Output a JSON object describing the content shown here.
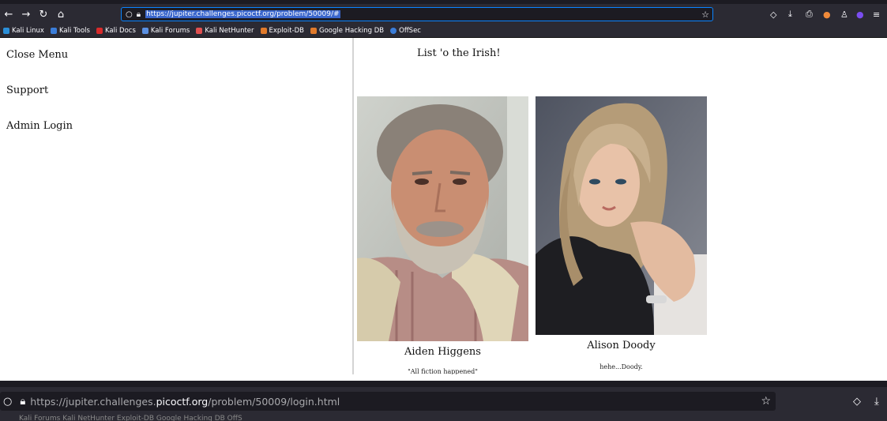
{
  "browser_top": {
    "url": "https://jupiter.challenges.picoctf.org/problem/50009/#",
    "bookmarks": [
      {
        "label": "Kali Linux",
        "color": "#2b8fd8"
      },
      {
        "label": "Kali Tools",
        "color": "#3b7dd8"
      },
      {
        "label": "Kali Docs",
        "color": "#d82b2b"
      },
      {
        "label": "Kali Forums",
        "color": "#5a8fe0"
      },
      {
        "label": "Kali NetHunter",
        "color": "#e05050"
      },
      {
        "label": "Exploit-DB",
        "color": "#e07a2b"
      },
      {
        "label": "Google Hacking DB",
        "color": "#e07a2b"
      },
      {
        "label": "OffSec",
        "color": "#3b7dd8"
      }
    ]
  },
  "menu": {
    "close": "Close Menu",
    "support": "Support",
    "admin": "Admin Login"
  },
  "main": {
    "title": "List 'o the Irish!",
    "people": [
      {
        "name": "Aiden Higgens",
        "quote": "\"All fiction happened\""
      },
      {
        "name": "Alison Doody",
        "quote": "hehe...Doody."
      }
    ]
  },
  "browser_bottom": {
    "url_prefix": "https://jupiter.challenges.",
    "url_domain": "picoctf.org",
    "url_suffix": "/problem/50009/login.html",
    "bookmarks_cut": "Kali Forums    Kali NetHunter    Exploit-DB    Google Hacking DB    OffS"
  }
}
